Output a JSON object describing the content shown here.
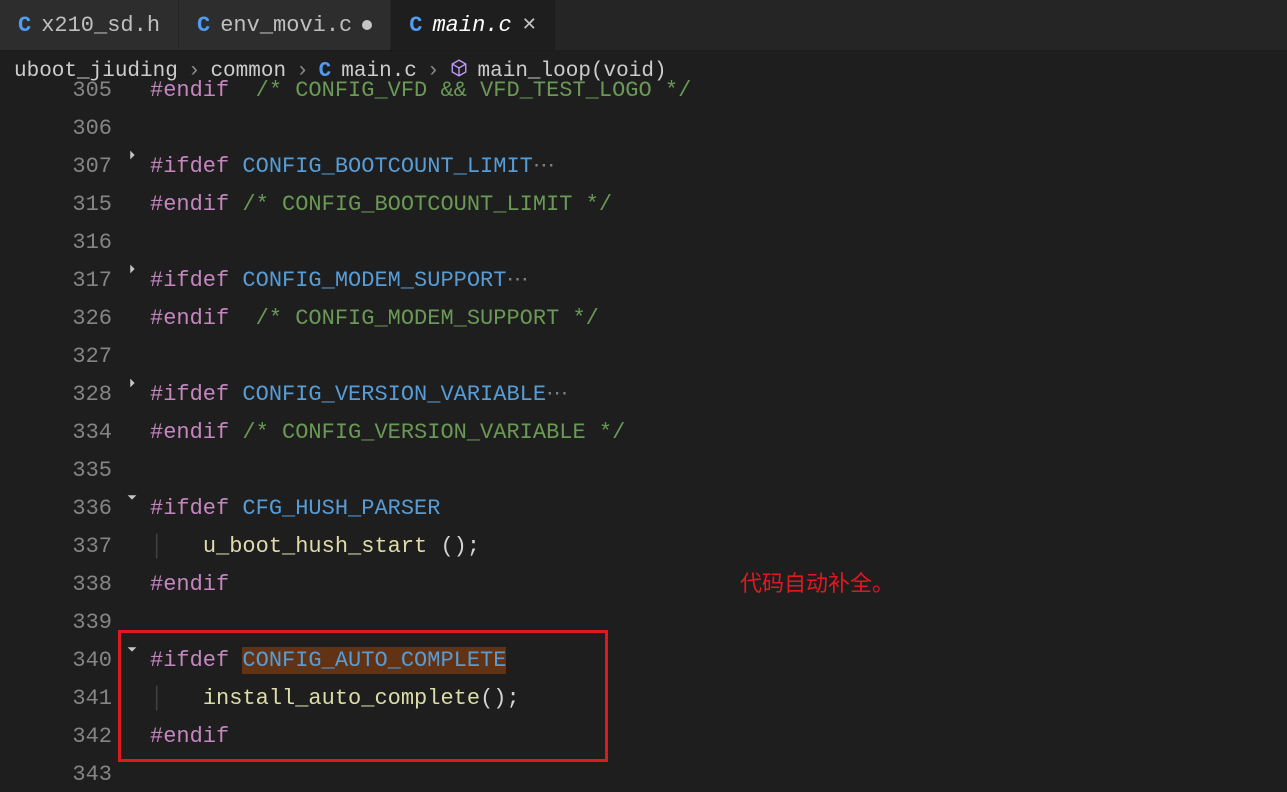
{
  "tabs": [
    {
      "icon": "C",
      "label": "x210_sd.h",
      "dirty": false,
      "active": false
    },
    {
      "icon": "C",
      "label": "env_movi.c",
      "dirty": true,
      "active": false
    },
    {
      "icon": "C",
      "label": "main.c",
      "dirty": false,
      "active": true
    }
  ],
  "breadcrumbs": {
    "parts": [
      "uboot_jiuding",
      "common"
    ],
    "file_icon": "C",
    "file": "main.c",
    "symbol": "main_loop(void)"
  },
  "lines": [
    {
      "n": "305",
      "fold": "",
      "kind": "endif_cmt",
      "t1": "#endif",
      "t2": "  /* CONFIG_VFD && VFD_TEST_LOGO */",
      "clip": true
    },
    {
      "n": "306",
      "fold": "",
      "kind": "blank"
    },
    {
      "n": "307",
      "fold": "right",
      "kind": "ifdef",
      "t1": "#ifdef",
      "t2": " CONFIG_BOOTCOUNT_LIMIT",
      "ell": "⋯",
      "foldbg": true
    },
    {
      "n": "315",
      "fold": "",
      "kind": "endif_cmt",
      "t1": "#endif",
      "t2": " /* CONFIG_BOOTCOUNT_LIMIT */"
    },
    {
      "n": "316",
      "fold": "",
      "kind": "blank"
    },
    {
      "n": "317",
      "fold": "right",
      "kind": "ifdef",
      "t1": "#ifdef",
      "t2": " CONFIG_MODEM_SUPPORT",
      "ell": "⋯",
      "foldbg": true
    },
    {
      "n": "326",
      "fold": "",
      "kind": "endif_cmt",
      "t1": "#endif",
      "t2": "  /* CONFIG_MODEM_SUPPORT */"
    },
    {
      "n": "327",
      "fold": "",
      "kind": "blank"
    },
    {
      "n": "328",
      "fold": "right",
      "kind": "ifdef",
      "t1": "#ifdef",
      "t2": " CONFIG_VERSION_VARIABLE",
      "ell": "⋯",
      "foldbg": true
    },
    {
      "n": "334",
      "fold": "",
      "kind": "endif_cmt",
      "t1": "#endif",
      "t2": " /* CONFIG_VERSION_VARIABLE */"
    },
    {
      "n": "335",
      "fold": "",
      "kind": "blank"
    },
    {
      "n": "336",
      "fold": "down",
      "kind": "ifdef",
      "t1": "#ifdef",
      "t2": " CFG_HUSH_PARSER"
    },
    {
      "n": "337",
      "fold": "",
      "kind": "call",
      "indent": "    ",
      "fn": "u_boot_hush_start",
      "args": " ();"
    },
    {
      "n": "338",
      "fold": "",
      "kind": "endif",
      "t1": "#endif"
    },
    {
      "n": "339",
      "fold": "",
      "kind": "blank"
    },
    {
      "n": "340",
      "fold": "down",
      "kind": "ifdef_hl",
      "t1": "#ifdef",
      "t2": "CONFIG_AUTO_COMPLETE"
    },
    {
      "n": "341",
      "fold": "",
      "kind": "call",
      "indent": "    ",
      "fn": "install_auto_complete",
      "args": "();"
    },
    {
      "n": "342",
      "fold": "",
      "kind": "endif",
      "t1": "#endif"
    },
    {
      "n": "343",
      "fold": "",
      "kind": "blank",
      "clip": true
    }
  ],
  "annotation": "代码自动补全。"
}
